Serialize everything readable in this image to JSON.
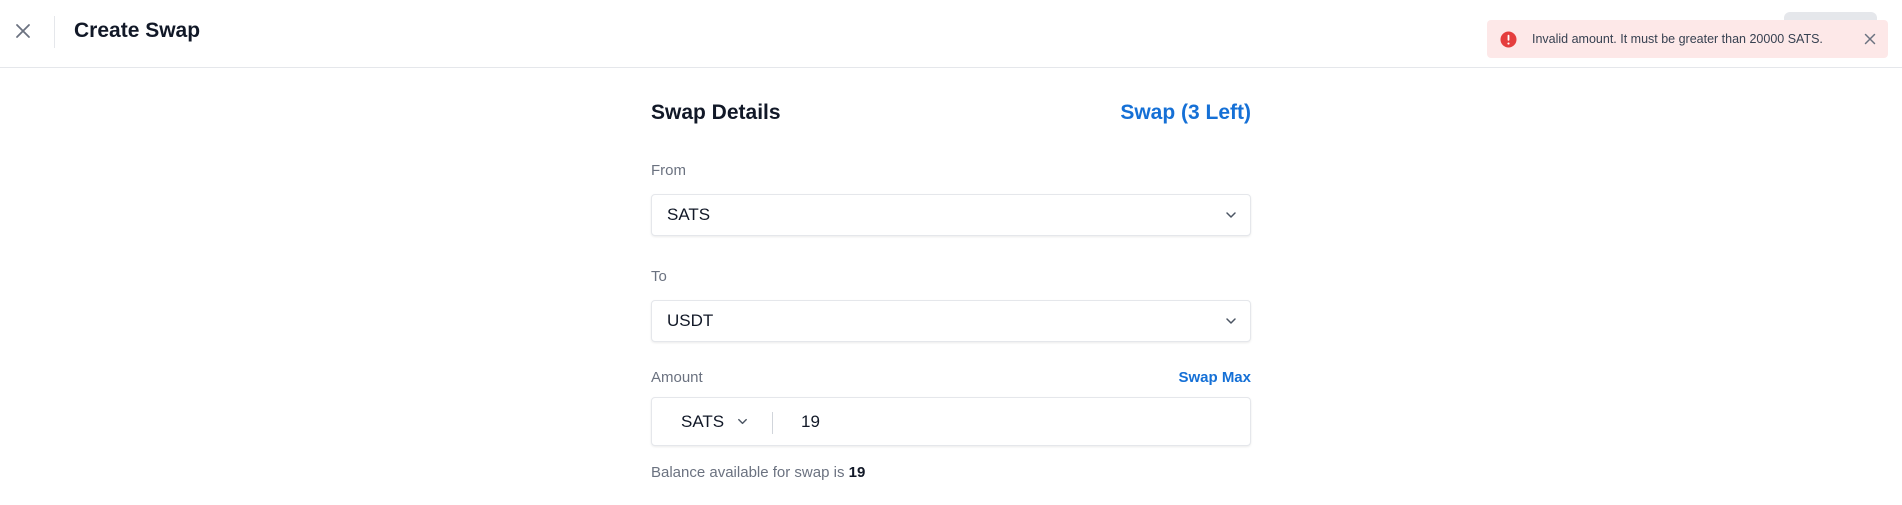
{
  "header": {
    "title": "Create Swap"
  },
  "toast": {
    "message": "Invalid amount. It must be greater than 20000 SATS."
  },
  "form": {
    "section_title": "Swap Details",
    "swap_count_label": "Swap (3 Left)",
    "from": {
      "label": "From",
      "value": "SATS"
    },
    "to": {
      "label": "To",
      "value": "USDT"
    },
    "amount": {
      "label": "Amount",
      "swap_max_label": "Swap Max",
      "unit": "SATS",
      "value": "19"
    },
    "balance": {
      "prefix": "Balance available for swap is ",
      "value": "19"
    }
  },
  "colors": {
    "accent": "#1570d6",
    "error": "#e53e3e",
    "toast_bg": "#fde8e8"
  },
  "icons": {
    "close": "close-icon",
    "error": "alert-circle-icon",
    "dropdown": "chevron-down-icon"
  }
}
